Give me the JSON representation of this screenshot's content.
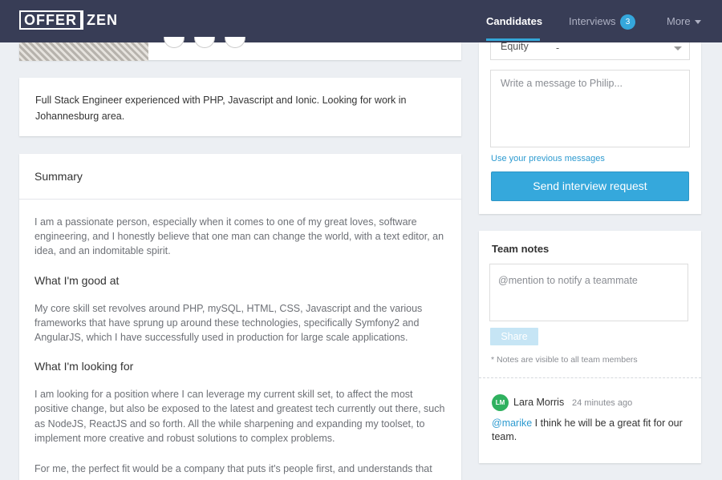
{
  "nav": {
    "logo_parts": [
      "OFFER",
      "ZEN"
    ],
    "candidates": "Candidates",
    "interviews": "Interviews",
    "interviews_count": "3",
    "more": "More"
  },
  "profile": {
    "about": "Full Stack Engineer experienced with PHP, Javascript and Ionic. Looking for work in Johannesburg area."
  },
  "summary": {
    "title": "Summary",
    "intro": "I am a passionate person, especially when it comes to one of my great loves, software engineering, and I honestly believe that one man can change the world, with a text editor, an idea, and an indomitable spirit.",
    "good_at_heading": "What I'm good at",
    "good_at": "My core skill set revolves around PHP, mySQL, HTML, CSS, Javascript and the various frameworks that have sprung up around these technologies, specifically Symfony2 and AngularJS, which I have successfully used in production for large scale applications.",
    "looking_for_heading": "What I'm looking for",
    "looking_for": "I am looking for a position where I can leverage my current skill set, to affect the most positive change, but also be exposed to the latest and greatest tech currently out there, such as NodeJS, ReactJS and so forth. All the while sharpening and expanding my toolset, to implement more creative and robust solutions to complex problems.",
    "perfect_fit": "For me, the perfect fit would be a company that puts it's people first, and understands that"
  },
  "request": {
    "equity_label": "Equity",
    "equity_value": "-",
    "message_placeholder": "Write a message to Philip...",
    "previous_messages": "Use your previous messages",
    "send_label": "Send interview request"
  },
  "team_notes": {
    "title": "Team notes",
    "placeholder": "@mention to notify a teammate",
    "share_label": "Share",
    "visibility": "* Notes are visible to all team members",
    "note": {
      "initials": "LM",
      "author": "Lara Morris",
      "time": "24 minutes ago",
      "mention": "@marike",
      "text": " I think he will be a great fit for our team."
    }
  },
  "colors": {
    "nav_bg": "#383d56",
    "accent": "#35a8dc",
    "avatar": "#2fb15f"
  }
}
